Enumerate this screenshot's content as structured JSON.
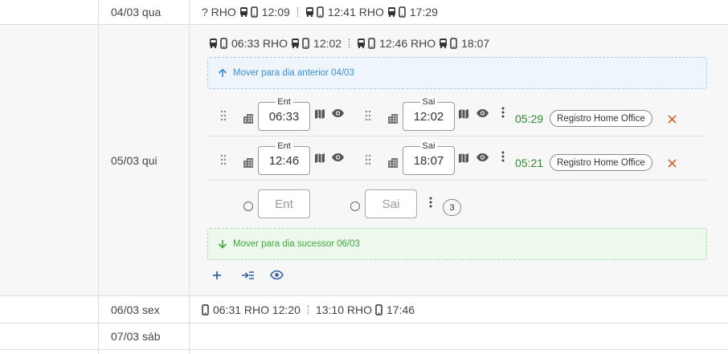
{
  "rows": [
    {
      "date": "04/03 qua",
      "summary": {
        "a_prefix": "? RHO",
        "a_time1": "12:09",
        "b_time1": "12:41 RHO",
        "b_time2": "17:29"
      }
    },
    {
      "date": "05/03 qui",
      "summary": {
        "a_time1": "06:33 RHO",
        "a_time2": "12:02",
        "b_time1": "12:46 RHO",
        "b_time2": "18:07"
      },
      "move_prev": "Mover para dia anterior 04/03",
      "move_next": "Mover para dia sucessor 06/03",
      "entries": [
        {
          "ent_label": "Ent",
          "ent_value": "06:33",
          "sai_label": "Sai",
          "sai_value": "12:02",
          "duration": "05:29",
          "tag": "Registro Home Office"
        },
        {
          "ent_label": "Ent",
          "ent_value": "12:46",
          "sai_label": "Sai",
          "sai_value": "18:07",
          "duration": "05:21",
          "tag": "Registro Home Office"
        }
      ],
      "new_entry": {
        "ent_placeholder": "Ent",
        "sai_placeholder": "Sai",
        "count": "3"
      }
    },
    {
      "date": "06/03 sex",
      "summary": {
        "a_time1": "06:31 RHO 12:20",
        "b_time1": "13:10 RHO",
        "b_time2": "17:46"
      }
    },
    {
      "date": "07/03 sáb"
    }
  ],
  "icons": {
    "bus": "bus-icon",
    "phone": "phone-icon",
    "building": "building-icon",
    "map": "map-icon",
    "eye": "eye-icon",
    "more": "more-vert-icon",
    "close": "close-icon",
    "drag": "drag-handle-icon",
    "add": "add-icon",
    "insert": "insert-icon",
    "arrow_up": "arrow-up-icon",
    "arrow_down": "arrow-down-icon"
  },
  "colors": {
    "blue_accent": "#3a8fd9",
    "green_accent": "#3daa3d",
    "duration": "#2d8a2d",
    "close": "#d9622b",
    "toolbar": "#2f5fa7"
  }
}
